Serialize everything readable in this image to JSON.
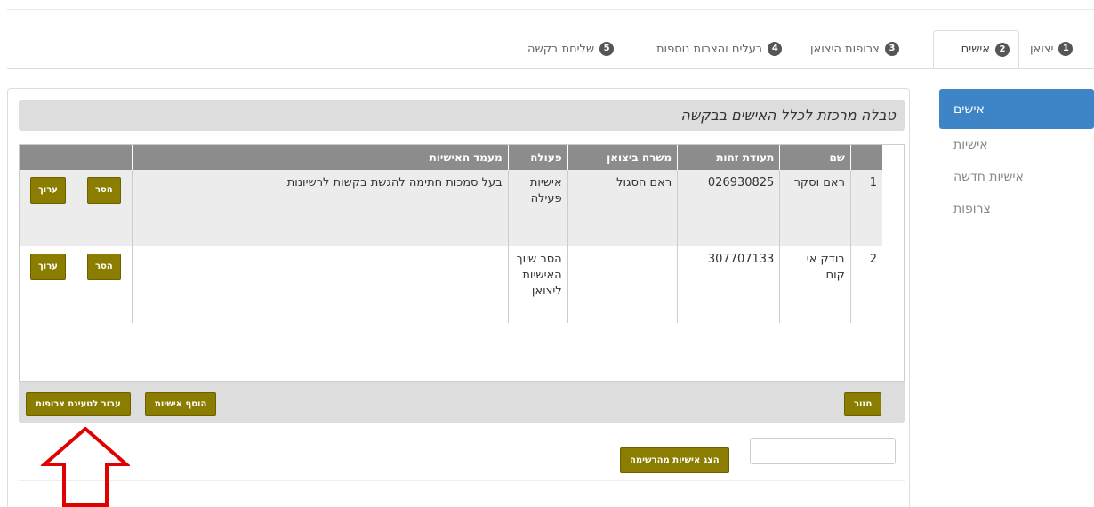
{
  "tabs": [
    {
      "num": "1",
      "label": "יצואן",
      "active": false
    },
    {
      "num": "2",
      "label": "אישים",
      "active": true
    },
    {
      "num": "3",
      "label": "צרופות היצואן",
      "active": false
    },
    {
      "num": "4",
      "label": "בעלים והצרות נוספות",
      "active": false
    },
    {
      "num": "5",
      "label": "שליחת בקשה",
      "active": false
    }
  ],
  "sidebar": {
    "items": [
      {
        "label": "אישים",
        "active": true
      },
      {
        "label": "אישיות",
        "active": false
      },
      {
        "label": "אישיות חדשה",
        "active": false
      },
      {
        "label": "צרופות",
        "active": false
      }
    ]
  },
  "panel": {
    "title": "טבלה מרכזת לכלל האישים בבקשה"
  },
  "table": {
    "headers": {
      "index": "",
      "name": "שם",
      "id": "תעודת זהות",
      "role": "משרה ביצואן",
      "action": "פעולה",
      "status": "מעמד האישיות"
    },
    "rows": [
      {
        "index": "1",
        "name": "ראם וסקר",
        "id": "026930825",
        "role": "ראם הסגול",
        "action": "אישיות פעילה",
        "status": "בעל סמכות חתימה להגשת בקשות לרשיונות",
        "remove": "הסר",
        "edit": "ערוך"
      },
      {
        "index": "2",
        "name": "בודק אי קום",
        "id": "307707133",
        "role": "",
        "action": "הסר שיוך האישיות ליצואן",
        "status": "",
        "remove": "הסר",
        "edit": "ערוך"
      }
    ]
  },
  "footer": {
    "back": "חזור",
    "add": "הוסף אישיות",
    "next": "עבור לטעינת צרופות"
  },
  "search": {
    "show_label": "הצג אישיות מהרשימה",
    "value": "",
    "placeholder": ""
  },
  "colors": {
    "accent": "#3d85c6",
    "button": "#8a7d00",
    "arrow": "#e00000"
  }
}
